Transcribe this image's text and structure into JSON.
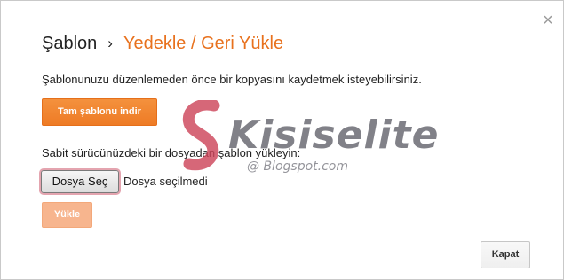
{
  "dialog": {
    "close_glyph": "×",
    "title": {
      "crumb": "Şablon",
      "separator": "›",
      "current": "Yedekle / Geri Yükle"
    },
    "backup": {
      "intro": "Şablonunuzu düzenlemeden önce bir kopyasını kaydetmek isteyebilirsiniz.",
      "download_label": "Tam şablonu indir"
    },
    "restore": {
      "file_label": "Sabit sürücünüzdeki bir dosyadan şablon yükleyin:",
      "choose_file_label": "Dosya Seç",
      "file_status": "Dosya seçilmedi",
      "upload_label": "Yükle"
    },
    "close_label": "Kapat"
  },
  "watermark": {
    "text": "Kisiselite",
    "sub": "@ Blogspot.com"
  },
  "colors": {
    "accent": "#e8711d",
    "primary_button": "#ee7b25",
    "disabled_button": "#f7b58e"
  },
  "icons": {
    "close": "close-icon"
  }
}
